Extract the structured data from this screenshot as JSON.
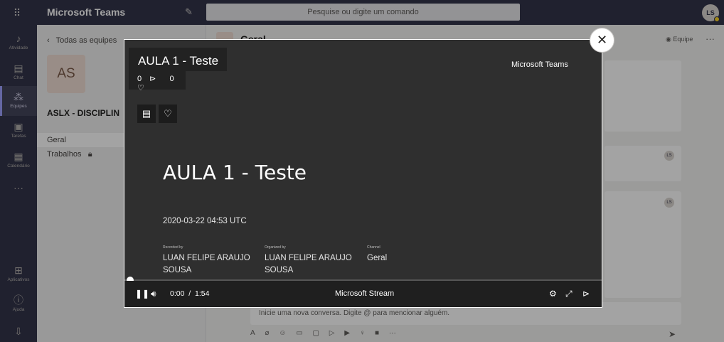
{
  "topbar": {
    "waffle_icon": "waffle-icon",
    "app_title": "Microsoft Teams",
    "search_placeholder": "Pesquise ou digite um comando",
    "user_initials": "LS",
    "presence_color": "#f8d22a"
  },
  "rail": {
    "items": [
      {
        "label": "Atividade",
        "icon": "bell-icon",
        "glyph": "🔔"
      },
      {
        "label": "Chat",
        "icon": "chat-icon",
        "glyph": "💬"
      },
      {
        "label": "Equipes",
        "icon": "teams-icon",
        "glyph": "👥"
      },
      {
        "label": "Tarefas",
        "icon": "tasks-icon",
        "glyph": "🎒"
      },
      {
        "label": "Calendário",
        "icon": "calendar-icon",
        "glyph": "📅"
      }
    ],
    "more": "···",
    "bottom": [
      {
        "label": "Aplicativos",
        "icon": "apps-icon",
        "glyph": "⊞"
      },
      {
        "label": "Ajuda",
        "icon": "help-icon",
        "glyph": "?"
      }
    ],
    "download_icon": "download-icon",
    "active_color": "#9ea2ff"
  },
  "teams_panel": {
    "back_label": "Todas as equipes",
    "team_initials": "AS",
    "team_name": "ASLX - DISCIPLIN",
    "channels": [
      {
        "label": "Geral"
      },
      {
        "label": "Trabalhos"
      }
    ]
  },
  "main": {
    "channel_title": "Geral",
    "team_button": "Equipe",
    "compose_placeholder": "Inicie uma nova conversa. Digite @ para mencionar alguém.",
    "badge": "LS"
  },
  "video": {
    "title": "AULA 1 - Teste",
    "views": "0",
    "likes": "0",
    "brand": "Microsoft Teams",
    "slide_title": "AULA 1 - Teste",
    "slide_date": "2020-03-22 04:53 UTC",
    "meta": [
      {
        "label": "Recorded by",
        "value": "LUAN FELIPE ARAUJO SOUSA"
      },
      {
        "label": "Organized by",
        "value": "LUAN FELIPE ARAUJO SOUSA"
      },
      {
        "label": "Channel",
        "value": "Geral"
      }
    ],
    "current_time": "0:00",
    "separator": "/",
    "duration": "1:54",
    "player_label": "Microsoft Stream",
    "progress": 0.0
  },
  "modal": {
    "close_icon": "close-icon"
  }
}
